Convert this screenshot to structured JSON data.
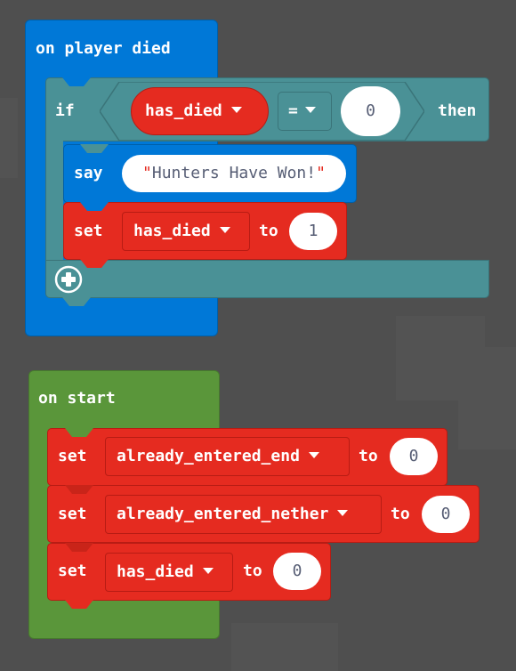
{
  "workspace": {
    "background_color": "#4f4f4f"
  },
  "colors": {
    "event_blue": "#0078d7",
    "logic_teal": "#4a9196",
    "variable_red": "#e52b20",
    "loops_green": "#5a963a",
    "input_text": "#575e75",
    "string_quote": "#e52b20"
  },
  "on_player_died": {
    "label": "on player died",
    "if_block": {
      "if_label": "if",
      "then_label": "then",
      "condition": {
        "variable": "has_died",
        "operator": "=",
        "value": "0"
      },
      "body": [
        {
          "type": "say",
          "label": "say",
          "quote_open": "\"",
          "text": "Hunters Have Won!",
          "quote_close": "\""
        },
        {
          "type": "set",
          "label": "set",
          "variable": "has_died",
          "to_label": "to",
          "value": "1"
        }
      ],
      "add_icon": "plus-circle-icon"
    }
  },
  "on_start": {
    "label": "on start",
    "body": [
      {
        "label": "set",
        "variable": "already_entered_end",
        "to_label": "to",
        "value": "0"
      },
      {
        "label": "set",
        "variable": "already_entered_nether",
        "to_label": "to",
        "value": "0"
      },
      {
        "label": "set",
        "variable": "has_died",
        "to_label": "to",
        "value": "0"
      }
    ]
  }
}
